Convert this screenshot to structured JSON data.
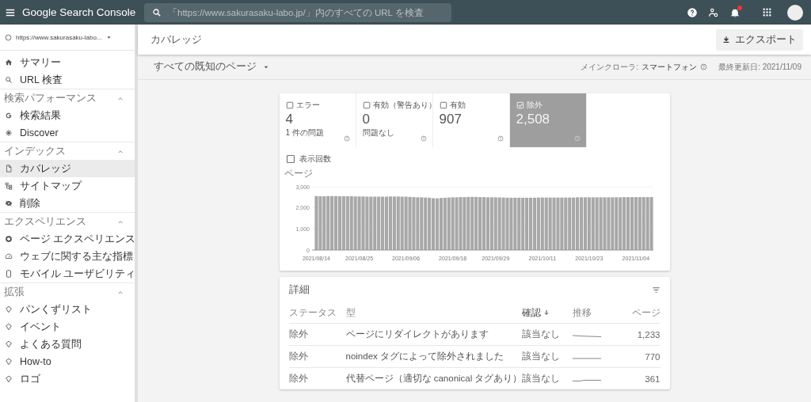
{
  "header": {
    "logo": "Google Search Console",
    "search": {
      "placeholder": "「https://www.sakurasaku-labo.jp/」内のすべての URL を検査"
    },
    "notification_dot": true
  },
  "sidebar": {
    "property": "https://www.sakurasaku-labo...",
    "items": [
      {
        "label": "サマリー",
        "selected": false
      },
      {
        "label": "URL 検査",
        "selected": false
      }
    ],
    "sections": [
      {
        "title": "検索パフォーマンス",
        "expanded": true,
        "items": [
          {
            "label": "検索結果",
            "selected": false
          },
          {
            "label": "Discover",
            "selected": false
          }
        ]
      },
      {
        "title": "インデックス",
        "expanded": true,
        "items": [
          {
            "label": "カバレッジ",
            "selected": true
          },
          {
            "label": "サイトマップ",
            "selected": false
          },
          {
            "label": "削除",
            "selected": false
          }
        ]
      },
      {
        "title": "エクスペリエンス",
        "expanded": true,
        "items": [
          {
            "label": "ページ エクスペリエンス",
            "selected": false
          },
          {
            "label": "ウェブに関する主な指標",
            "selected": false
          },
          {
            "label": "モバイル ユーザビリティ",
            "selected": false
          }
        ]
      },
      {
        "title": "拡張",
        "expanded": true,
        "items": [
          {
            "label": "パンくずリスト",
            "selected": false
          },
          {
            "label": "イベント",
            "selected": false
          },
          {
            "label": "よくある質問",
            "selected": false
          },
          {
            "label": "How-to",
            "selected": false
          },
          {
            "label": "ロゴ",
            "selected": false
          }
        ]
      }
    ]
  },
  "page": {
    "title": "カバレッジ",
    "export_button": "エクスポート",
    "filter": "すべての既知のページ",
    "crawler_label": "メインクローラ:",
    "crawler_value": "スマートフォン",
    "updated": "最終更新日: 2021/11/09"
  },
  "cards": [
    {
      "label": "エラー",
      "value": "4",
      "subtitle": "1 件の問題",
      "checked": false
    },
    {
      "label": "有効（警告あり）",
      "value": "0",
      "subtitle": "問題なし",
      "checked": false
    },
    {
      "label": "有効",
      "value": "907",
      "checked": false
    },
    {
      "label": "除外",
      "value": "2,508",
      "checked": true
    }
  ],
  "impressions": {
    "label": "表示回数",
    "checked": false
  },
  "chart_data": {
    "type": "bar",
    "ylabel": "ページ",
    "categories": [
      "2021/08/14",
      null,
      null,
      null,
      null,
      null,
      null,
      null,
      null,
      null,
      null,
      "2021/08/25",
      null,
      null,
      null,
      null,
      null,
      null,
      null,
      null,
      null,
      null,
      null,
      "2021/09/06",
      null,
      null,
      null,
      null,
      null,
      null,
      null,
      null,
      null,
      null,
      null,
      "2021/09/18",
      null,
      null,
      null,
      null,
      null,
      null,
      null,
      null,
      null,
      null,
      "2021/09/29",
      null,
      null,
      null,
      null,
      null,
      null,
      null,
      null,
      null,
      null,
      null,
      "2021/10/11",
      null,
      null,
      null,
      null,
      null,
      null,
      null,
      null,
      null,
      null,
      null,
      "2021/10/23",
      null,
      null,
      null,
      null,
      null,
      null,
      null,
      null,
      null,
      null,
      null,
      "2021/11/04",
      null,
      null,
      null,
      null
    ],
    "series": [
      {
        "color": "#a8a8a8",
        "values": [
          2560,
          2550,
          2550,
          2560,
          2560,
          2560,
          2550,
          2550,
          2550,
          2550,
          2540,
          2540,
          2540,
          2530,
          2530,
          2530,
          2530,
          2530,
          2530,
          2540,
          2540,
          2540,
          2530,
          2530,
          2520,
          2510,
          2500,
          2500,
          2490,
          2480,
          2460,
          2450,
          2470,
          2480,
          2490,
          2500,
          2500,
          2510,
          2510,
          2520,
          2520,
          2520,
          2510,
          2510,
          2500,
          2500,
          2500,
          2490,
          2490,
          2480,
          2480,
          2480,
          2480,
          2480,
          2480,
          2480,
          2480,
          2490,
          2490,
          2490,
          2490,
          2490,
          2490,
          2490,
          2490,
          2490,
          2490,
          2500,
          2500,
          2500,
          2500,
          2500,
          2500,
          2500,
          2500,
          2500,
          2500,
          2500,
          2500,
          2510,
          2510,
          2510,
          2510,
          2510,
          2510,
          2510,
          2510
        ]
      }
    ],
    "ylim": [
      0,
      3000
    ],
    "yticks": [
      {
        "value": 0,
        "label": "0"
      },
      {
        "value": 1000,
        "label": "1,000"
      },
      {
        "value": 2000,
        "label": "2,000"
      },
      {
        "value": 3000,
        "label": "3,000"
      }
    ]
  },
  "details": {
    "title": "詳細",
    "columns": [
      {
        "label": "ステータス",
        "sorted": false
      },
      {
        "label": "型",
        "sorted": false
      },
      {
        "label": "確認",
        "sorted": true
      },
      {
        "label": "推移",
        "sorted": false
      },
      {
        "label": "ページ",
        "sorted": false
      }
    ],
    "rows": [
      {
        "status": "除外",
        "type": "ページにリダイレクトがあります",
        "validation": "該当なし",
        "pages": "1,233"
      },
      {
        "status": "除外",
        "type": "noindex タグによって除外されました",
        "validation": "該当なし",
        "pages": "770"
      },
      {
        "status": "除外",
        "type": "代替ページ（適切な canonical タグあり）",
        "validation": "該当なし",
        "pages": "361"
      }
    ]
  }
}
